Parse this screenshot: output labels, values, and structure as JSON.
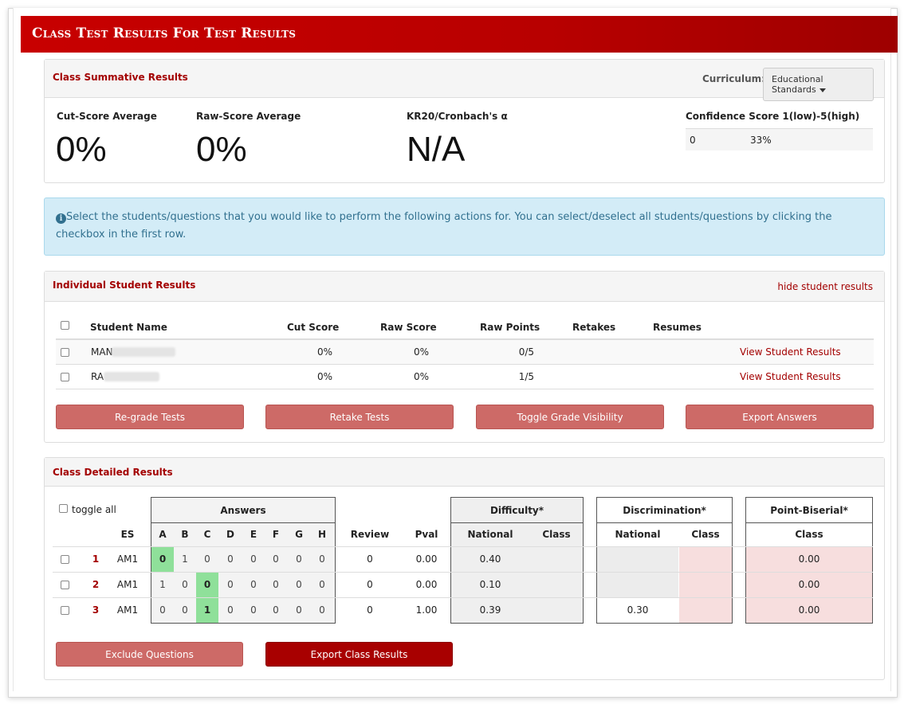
{
  "page_title": "Class Test Results For Test Results",
  "summative": {
    "title": "Class Summative Results",
    "curriculum_label": "Curriculum:",
    "curriculum_value": "Educational Standards",
    "cut_label": "Cut-Score Average",
    "cut_value": "0%",
    "raw_label": "Raw-Score Average",
    "raw_value": "0%",
    "kr20_label": "KR20/Cronbach's α",
    "kr20_value": "N/A",
    "conf_label": "Confidence Score 1(low)-5(high)",
    "conf_score": "0",
    "conf_pct": "33%"
  },
  "info_text": "Select the students/questions that you would like to perform the following actions for. You can select/deselect all students/questions by clicking the checkbox in the first row.",
  "students": {
    "title": "Individual Student Results",
    "hide_link": "hide student results",
    "headers": {
      "name": "Student Name",
      "cut": "Cut Score",
      "raw": "Raw Score",
      "points": "Raw Points",
      "retakes": "Retakes",
      "resumes": "Resumes"
    },
    "rows": [
      {
        "name": "MAN",
        "cut": "0%",
        "raw": "0%",
        "points": "0/5",
        "link": "View Student Results"
      },
      {
        "name": "RA",
        "cut": "0%",
        "raw": "0%",
        "points": "1/5",
        "link": "View Student Results"
      }
    ],
    "buttons": {
      "regrade": "Re-grade Tests",
      "retake": "Retake Tests",
      "toggle": "Toggle Grade Visibility",
      "export": "Export Answers"
    }
  },
  "detailed": {
    "title": "Class Detailed Results",
    "toggle_all": "toggle all",
    "answers_header": "Answers",
    "difficulty_header": "Difficulty*",
    "discrimination_header": "Discrimination*",
    "pointbiserial_header": "Point-Biserial*",
    "cols": {
      "es": "ES",
      "a": "A",
      "b": "B",
      "c": "C",
      "d": "D",
      "e": "E",
      "f": "F",
      "g": "G",
      "h": "H",
      "review": "Review",
      "pval": "Pval",
      "diff_nat": "National",
      "diff_class": "Class",
      "disc_nat": "National",
      "disc_class": "Class",
      "pb_class": "Class"
    },
    "rows": [
      {
        "num": "1",
        "es": "AM1",
        "ans": [
          "0",
          "1",
          "0",
          "0",
          "0",
          "0",
          "0",
          "0"
        ],
        "correct": 0,
        "review": "0",
        "pval": "0.00",
        "diff_nat": "0.40",
        "diff_class": "",
        "disc_nat": "",
        "disc_class": "",
        "pb": "0.00"
      },
      {
        "num": "2",
        "es": "AM1",
        "ans": [
          "1",
          "0",
          "0",
          "0",
          "0",
          "0",
          "0",
          "0"
        ],
        "correct": 2,
        "review": "0",
        "pval": "0.00",
        "diff_nat": "0.10",
        "diff_class": "",
        "disc_nat": "",
        "disc_class": "",
        "pb": "0.00"
      },
      {
        "num": "3",
        "es": "AM1",
        "ans": [
          "0",
          "0",
          "1",
          "0",
          "0",
          "0",
          "0",
          "0"
        ],
        "correct": 2,
        "review": "0",
        "pval": "1.00",
        "diff_nat": "0.39",
        "diff_class": "",
        "disc_nat": "0.30",
        "disc_class": "",
        "pb": "0.00"
      }
    ],
    "buttons": {
      "exclude": "Exclude Questions",
      "export": "Export Class Results"
    }
  },
  "colors": {
    "brand_red": "#b80000",
    "link_red": "#a30000",
    "correct_green": "#8fe09a",
    "pb_pink": "#f7dede"
  }
}
